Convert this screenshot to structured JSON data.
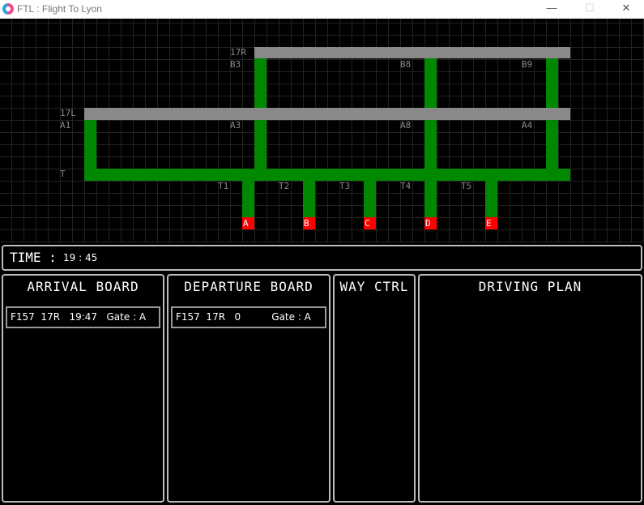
{
  "window": {
    "title": "FTL : Flight To Lyon",
    "minimize": "—",
    "maximize": "☐",
    "close": "✕"
  },
  "map": {
    "runways": [
      {
        "label": "17R"
      },
      {
        "label": "17L"
      }
    ],
    "junctions": [
      "B3",
      "B8",
      "B9",
      "A1",
      "A3",
      "A8",
      "A4"
    ],
    "taxiway_main": "T",
    "taxiways": [
      "T1",
      "T2",
      "T3",
      "T4",
      "T5"
    ],
    "gates": [
      "A",
      "B",
      "C",
      "D",
      "E"
    ],
    "colors": {
      "runway": "#898989",
      "taxiway": "#008800",
      "gate": "#ff0000",
      "grid": "#222222"
    }
  },
  "time": {
    "label": "TIME :",
    "value": "19 : 45"
  },
  "arrival": {
    "title": "ARRIVAL BOARD",
    "entries": [
      "F157  17R   19:47   Gate : A"
    ]
  },
  "departure": {
    "title": "DEPARTURE BOARD",
    "entries": [
      "F157  17R   0          Gate : A"
    ]
  },
  "way_ctrl": {
    "title": "WAY CTRL"
  },
  "driving_plan": {
    "title": "DRIVING PLAN"
  }
}
